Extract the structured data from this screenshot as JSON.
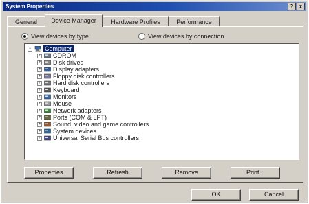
{
  "window": {
    "title": "System Properties",
    "help_glyph": "?",
    "close_glyph": "x"
  },
  "tabs": [
    {
      "label": "General"
    },
    {
      "label": "Device Manager"
    },
    {
      "label": "Hardware Profiles"
    },
    {
      "label": "Performance"
    }
  ],
  "view_options": {
    "by_type": "View devices by type",
    "by_connection": "View devices by connection"
  },
  "tree": {
    "root": "Computer",
    "items": [
      {
        "label": "CDROM",
        "icon": "cdrom-icon",
        "color": "#6a7a8a"
      },
      {
        "label": "Disk drives",
        "icon": "disk-drive-icon",
        "color": "#8a8a8a"
      },
      {
        "label": "Display adapters",
        "icon": "display-adapter-icon",
        "color": "#2f5f9f"
      },
      {
        "label": "Floppy disk controllers",
        "icon": "floppy-controller-icon",
        "color": "#7a7a9a"
      },
      {
        "label": "Hard disk controllers",
        "icon": "hard-disk-controller-icon",
        "color": "#7a7a7a"
      },
      {
        "label": "Keyboard",
        "icon": "keyboard-icon",
        "color": "#5a5a5a"
      },
      {
        "label": "Monitors",
        "icon": "monitor-icon",
        "color": "#3a6aaa"
      },
      {
        "label": "Mouse",
        "icon": "mouse-icon",
        "color": "#9a9a9a"
      },
      {
        "label": "Network adapters",
        "icon": "network-adapter-icon",
        "color": "#3a8a3a"
      },
      {
        "label": "Ports (COM & LPT)",
        "icon": "ports-icon",
        "color": "#6a6a3a"
      },
      {
        "label": "Sound, video and game controllers",
        "icon": "sound-controller-icon",
        "color": "#9a5a2a"
      },
      {
        "label": "System devices",
        "icon": "system-devices-icon",
        "color": "#2a6a9a"
      },
      {
        "label": "Universal Serial Bus controllers",
        "icon": "usb-controller-icon",
        "color": "#4a4a8a"
      }
    ]
  },
  "panel_buttons": {
    "properties": "Properties",
    "refresh": "Refresh",
    "remove": "Remove",
    "print": "Print..."
  },
  "dialog_buttons": {
    "ok": "OK",
    "cancel": "Cancel"
  },
  "colors": {
    "titlebar": "#0a246a",
    "selection": "#0a246a",
    "face": "#d4d0c8"
  }
}
